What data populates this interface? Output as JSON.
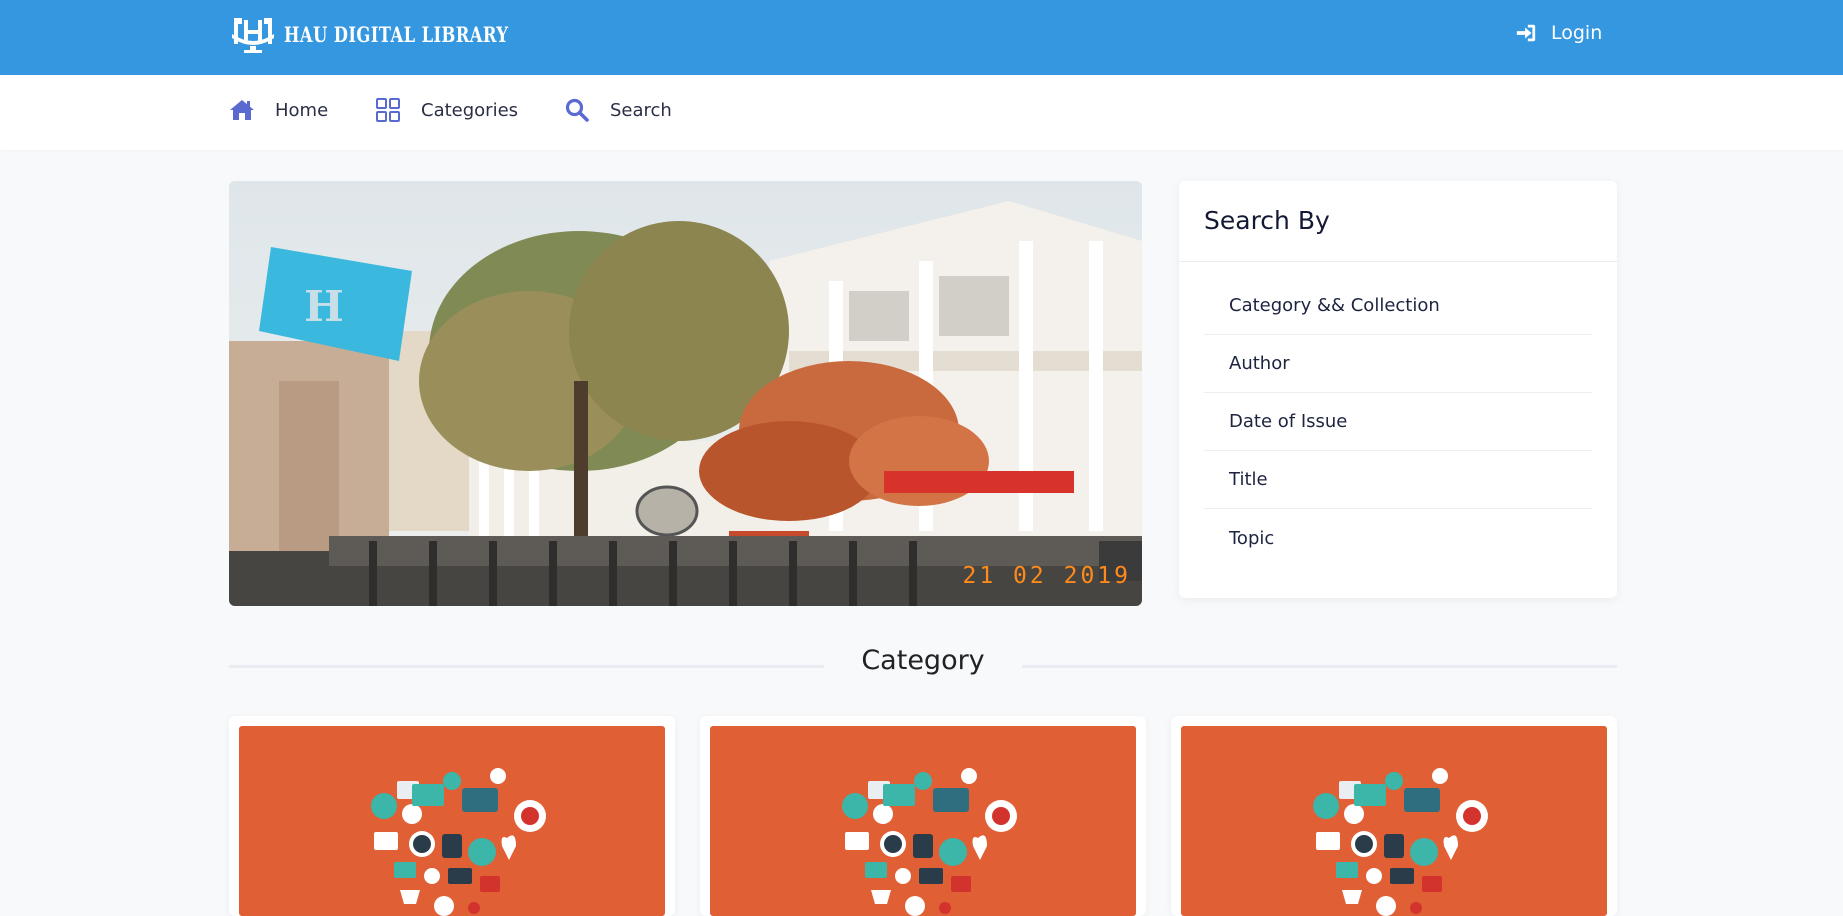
{
  "header": {
    "logo_text": "HAU DIGITAL LIBRARY",
    "login_label": "Login",
    "bg_color": "#3597e0"
  },
  "nav": {
    "items": [
      {
        "label": "Home",
        "icon": "home-icon"
      },
      {
        "label": "Categories",
        "icon": "grid-icon"
      },
      {
        "label": "Search",
        "icon": "search-icon"
      }
    ],
    "icon_color": "#5b6ad0"
  },
  "hero": {
    "date_stamp": "21 02 2019",
    "sign_text": "H"
  },
  "search_by": {
    "title": "Search By",
    "items": [
      "Category && Collection",
      "Author",
      "Date of Issue",
      "Title",
      "Topic"
    ]
  },
  "category": {
    "heading": "Category",
    "card_color": "#e05f34"
  }
}
